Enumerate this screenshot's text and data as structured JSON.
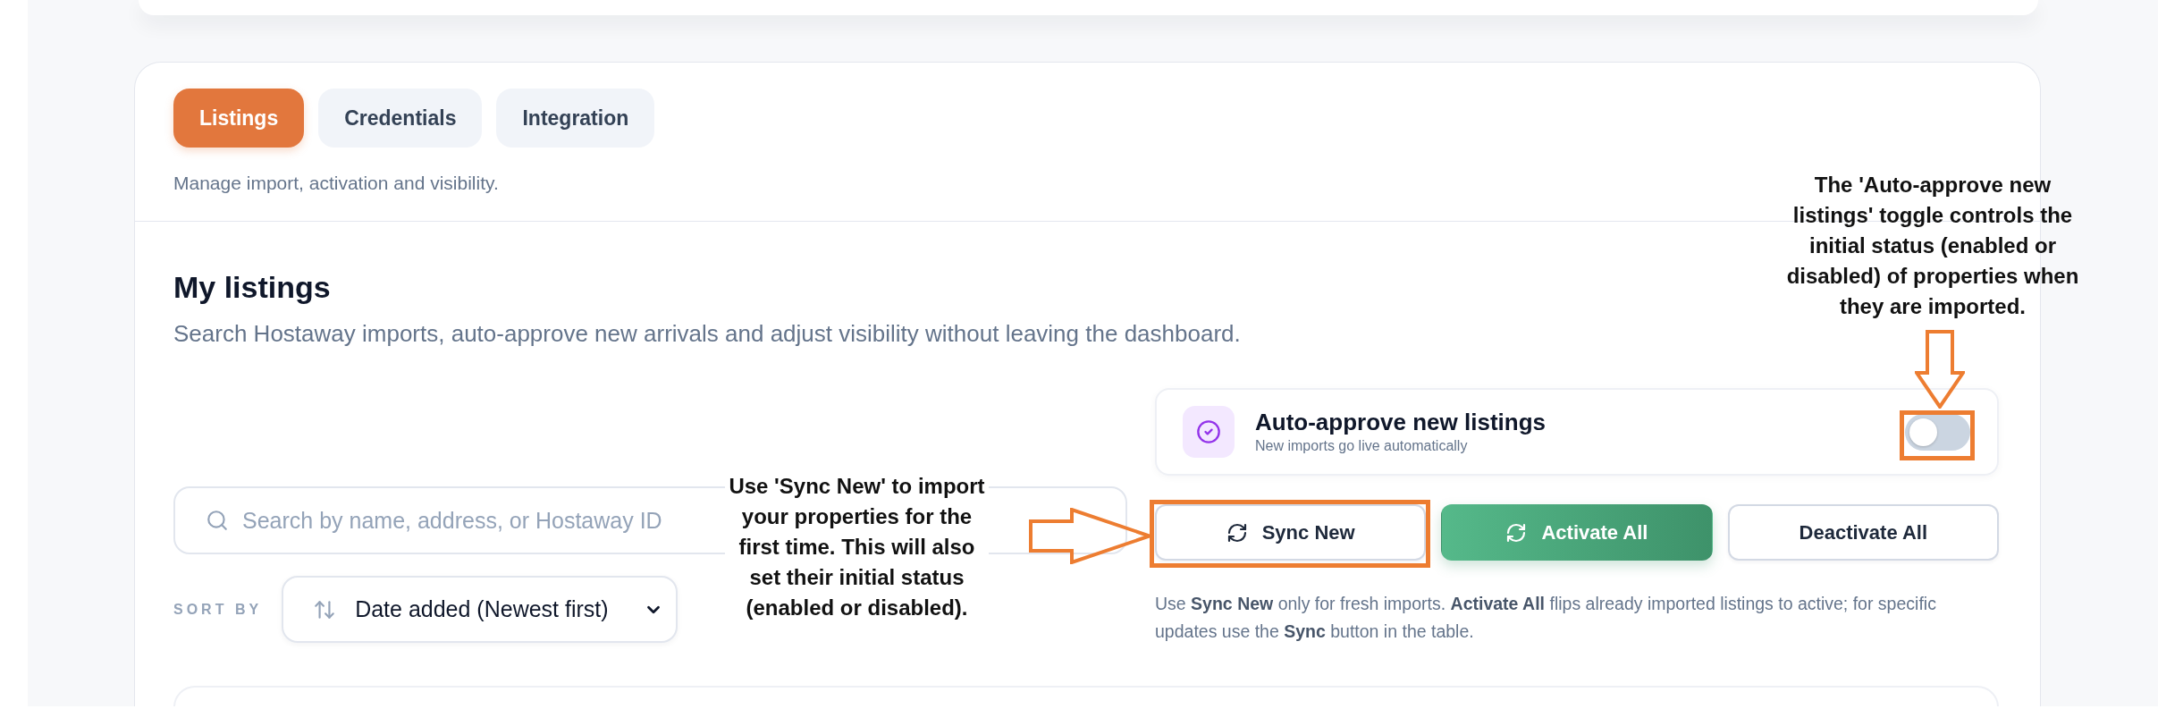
{
  "tabs": [
    {
      "label": "Listings",
      "selected": true
    },
    {
      "label": "Credentials",
      "selected": false
    },
    {
      "label": "Integration",
      "selected": false
    }
  ],
  "tabs_caption": "Manage import, activation and visibility.",
  "section": {
    "title": "My listings",
    "description": "Search Hostaway imports, auto-approve new arrivals and adjust visibility without leaving the dashboard."
  },
  "search": {
    "placeholder": "Search by name, address, or Hostaway ID"
  },
  "sort": {
    "label": "SORT BY",
    "value": "Date added (Newest first)"
  },
  "auto_approve": {
    "title": "Auto-approve new listings",
    "subtitle": "New imports go live automatically",
    "on": false
  },
  "actions": [
    {
      "label": "Sync New",
      "kind": "outline",
      "icon": true
    },
    {
      "label": "Activate All",
      "kind": "primary",
      "icon": true
    },
    {
      "label": "Deactivate All",
      "kind": "outline",
      "icon": false
    }
  ],
  "note": "Use **Sync New** only for fresh imports. **Activate All** flips already imported listings to active; for specific updates use the **Sync** button in the table.",
  "callouts": [
    {
      "kind": "toggle",
      "text": "The 'Auto-approve new listings' toggle controls the initial status (enabled or disabled) of properties when they are imported."
    },
    {
      "kind": "sync",
      "text": "Use 'Sync New' to import your properties for the first time. This will also set their initial status (enabled or disabled)."
    }
  ]
}
